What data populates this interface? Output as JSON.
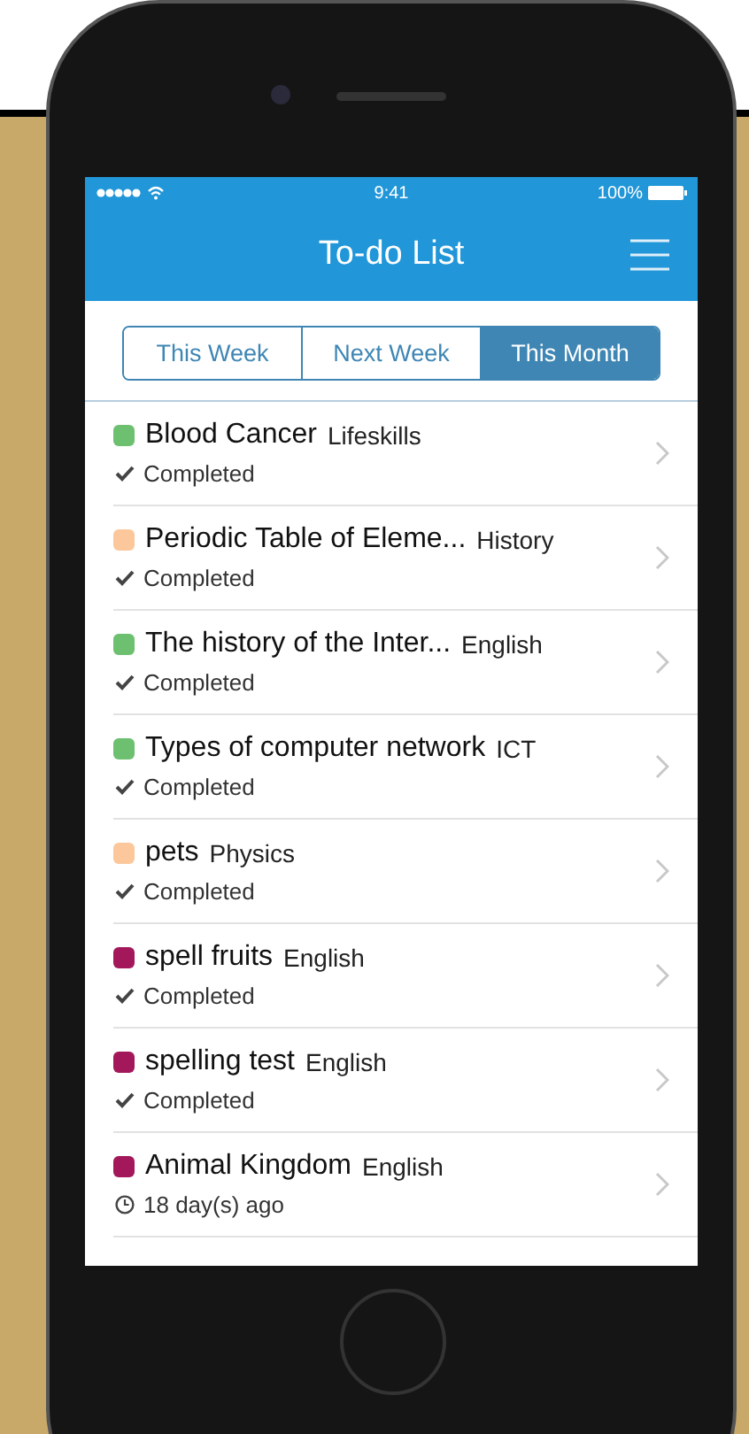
{
  "status_bar": {
    "time": "9:41",
    "battery": "100%"
  },
  "header": {
    "title": "To-do List"
  },
  "tabs": [
    {
      "label": "This Week",
      "selected": false
    },
    {
      "label": "Next Week",
      "selected": false
    },
    {
      "label": "This Month",
      "selected": true
    }
  ],
  "tasks": [
    {
      "title": "Blood Cancer",
      "subject": "Lifeskills",
      "color": "#6cc070",
      "status": {
        "kind": "completed",
        "text": "Completed"
      }
    },
    {
      "title": "Periodic Table of Eleme...",
      "subject": "History",
      "color": "#fcc89b",
      "status": {
        "kind": "completed",
        "text": "Completed"
      }
    },
    {
      "title": "The history of the Inter...",
      "subject": "English",
      "color": "#6cc070",
      "status": {
        "kind": "completed",
        "text": "Completed"
      }
    },
    {
      "title": "Types of computer network",
      "subject": "ICT",
      "color": "#6cc070",
      "status": {
        "kind": "completed",
        "text": "Completed"
      }
    },
    {
      "title": "pets",
      "subject": "Physics",
      "color": "#fcc89b",
      "status": {
        "kind": "completed",
        "text": "Completed"
      }
    },
    {
      "title": "spell fruits",
      "subject": "English",
      "color": "#a3185a",
      "status": {
        "kind": "completed",
        "text": "Completed"
      }
    },
    {
      "title": "spelling test",
      "subject": "English",
      "color": "#a3185a",
      "status": {
        "kind": "completed",
        "text": "Completed"
      }
    },
    {
      "title": "Animal Kingdom",
      "subject": "English",
      "color": "#a3185a",
      "status": {
        "kind": "age",
        "text": "18 day(s) ago"
      }
    }
  ]
}
